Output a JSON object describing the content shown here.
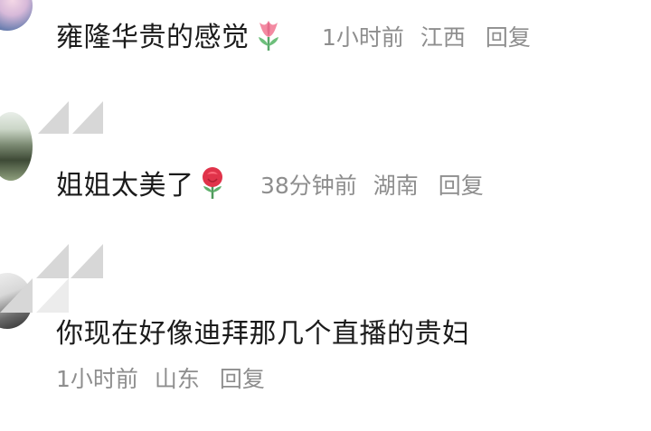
{
  "comments": [
    {
      "text": "雍隆华贵的感觉",
      "emoji": "tulip-icon",
      "time": "1小时前",
      "location": "江西",
      "reply_label": "回复"
    },
    {
      "text": "姐姐太美了",
      "emoji": "rose-icon",
      "time": "38分钟前",
      "location": "湖南",
      "reply_label": "回复"
    },
    {
      "text": "你现在好像迪拜那几个直播的贵妇",
      "time": "1小时前",
      "location": "山东",
      "reply_label": "回复"
    }
  ],
  "colors": {
    "text": "#1b1b1b",
    "meta": "#8e8e8e",
    "placeholder": "#d7d7d7"
  }
}
